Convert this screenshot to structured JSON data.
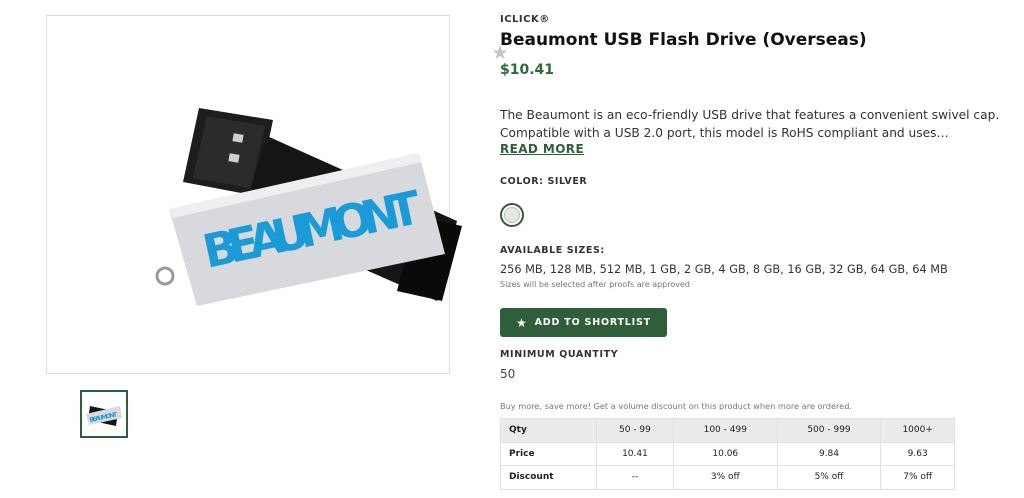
{
  "product": {
    "brand": "ICLICK®",
    "title": "Beaumont USB Flash Drive (Overseas)",
    "price": "$10.41",
    "description_line1": "The Beaumont is an eco-friendly USB drive that features a convenient swivel cap.",
    "description_line2": "Compatible with a USB 2.0 port, this model is RoHS compliant and uses name brand memory chips.",
    "read_more": "READ MORE",
    "imprint_text": "BEAUMONT"
  },
  "color": {
    "label": "COLOR: SILVER",
    "swatch_hex": "#e6e6e6"
  },
  "sizes": {
    "label": "AVAILABLE SIZES:",
    "list": "256 MB, 128 MB, 512 MB, 1 GB, 2 GB, 4 GB, 8 GB, 16 GB, 32 GB, 64 GB, 64 MB",
    "note": "Sizes will be selected after proofs are approved"
  },
  "actions": {
    "shortlist_label": "ADD TO SHORTLIST",
    "favorite_icon": "star-icon"
  },
  "minimum": {
    "label": "MINIMUM QUANTITY",
    "value": "50"
  },
  "pricing": {
    "note": "Buy more, save more! Get a volume discount on this product when more are ordered.",
    "headers": [
      "Qty",
      "50 - 99",
      "100 - 499",
      "500 - 999",
      "1000+"
    ],
    "price_row": [
      "Price",
      "10.41",
      "10.06",
      "9.84",
      "9.63"
    ],
    "discount_row": [
      "Discount",
      "--",
      "3% off",
      "5% off",
      "7% off"
    ]
  },
  "colors": {
    "accent": "#2e5e3a",
    "price": "#2e6b3a",
    "imprint_blue": "#1a9bd7"
  }
}
